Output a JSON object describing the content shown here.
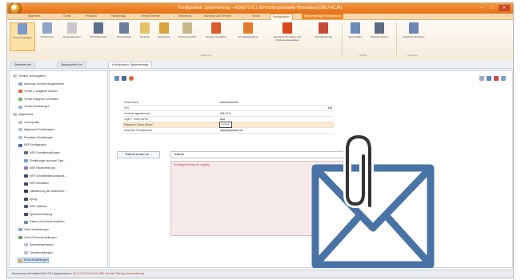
{
  "window": {
    "title": "Konfiguration: Systemeintrag – AQASYS 6.1 (Einrichtungsbeispiel Hörsaalbau) [DEU-ACJA]"
  },
  "menu_tabs": [
    "Allgemein",
    "Grafik",
    "Protokoll",
    "Handelstag",
    "Termin/Termine",
    "Steuerung",
    "Warnung und Termine",
    "Extras",
    "Konfiguration"
  ],
  "special_tab": "Planwerkzeuge Konfigurieren",
  "ribbon": {
    "buttons": [
      {
        "label": "Prozessvariablen",
        "color": "#7a98c9"
      },
      {
        "label": "PV-Bereiche",
        "color": "#8fa7c7"
      },
      {
        "label": "Datenparameter",
        "color": "#c9c9c9"
      },
      {
        "label": "SPS-Parameter",
        "color": "#5c6f8a"
      },
      {
        "label": "Prozessbilder",
        "color": "#6b7f99"
      },
      {
        "label": "Protokoll",
        "color": "#e6c26b"
      },
      {
        "label": "Dokumente",
        "color": "#d9a33e"
      },
      {
        "label": "Rechtevorschrift",
        "color": "#c7b98c"
      },
      {
        "label": "Stundenverwaltung",
        "color": "#d95a2b"
      },
      {
        "label": "Prioritätsausgänge",
        "color": "#e07d2a"
      },
      {
        "label": "Erweiterte Prioritäten und Quittierungsausgänge",
        "color": "#d9481e"
      },
      {
        "label": "Fernalarmierung",
        "color": "#c44b3a"
      },
      {
        "label": "Systemdaten",
        "color": "#6b8cb8"
      },
      {
        "label": "Passwort ändern",
        "color": "#5b6c82"
      },
      {
        "label": "Registrierschlüsseln",
        "color": "#6c86b6"
      }
    ],
    "groups": [
      "Allgemein",
      "System",
      "Sonstiges"
    ]
  },
  "doc_tabs": [
    "Startseite.frm",
    "Datenquellen.frm",
    "Konfiguration: Systemeintrag"
  ],
  "sidebar": {
    "items": [
      {
        "label": "Termine und Aufgaben",
        "indent": 0,
        "color": "#c0c7d1"
      },
      {
        "label": "Wartungs-Termine reorganisieren",
        "indent": 1,
        "color": "#8fa7c7"
      },
      {
        "label": "Termin u. Aufgaben löschen",
        "indent": 1,
        "color": "#d36a4d"
      },
      {
        "label": "Termin-Kategorien verwalten",
        "indent": 1,
        "color": "#7bb26b"
      },
      {
        "label": "Termin-Einstellungen",
        "indent": 1,
        "color": "#9ab0cf"
      },
      {
        "label": "Allgemeines",
        "indent": 0,
        "color": "#c0c7d1"
      },
      {
        "label": "Lizenzprofile",
        "indent": 1,
        "color": "#b6c4d4"
      },
      {
        "label": "Allgemeine Einstellungen",
        "indent": 1,
        "color": "#b6c4d4"
      },
      {
        "label": "Erweiterte Einstellungen",
        "indent": 1,
        "color": "#b6c4d4"
      },
      {
        "label": "NSP Konfiguration",
        "indent": 1,
        "color": "#4d6d99"
      },
      {
        "label": "NSP-Grundeinstellungen",
        "indent": 2,
        "color": "#5c6f8a"
      },
      {
        "label": "Einstellungen automat. Spei...",
        "indent": 2,
        "color": "#6fa0d3"
      },
      {
        "label": "NSP-Parametrierung",
        "indent": 2,
        "color": "#8e7bb8"
      },
      {
        "label": "NSP-Schnittstellenkonfigurat...",
        "indent": 2,
        "color": "#3d4a60"
      },
      {
        "label": "NSP-Simulation",
        "indent": 2,
        "color": "#3d4a60"
      },
      {
        "label": "Initialisierung der Modemsch...",
        "indent": 2,
        "color": "#2f3a4d"
      },
      {
        "label": "Sprog",
        "indent": 2,
        "color": "#3d4a60"
      },
      {
        "label": "NSP-Optionen",
        "indent": 2,
        "color": "#4a5a73"
      },
      {
        "label": "Speicherauflösung",
        "indent": 2,
        "color": "#3d4a60"
      },
      {
        "label": "Datum und Uhrzeit einstellen",
        "indent": 2,
        "color": "#6f8aa8"
      },
      {
        "label": "Client-Verbindungen",
        "indent": 1,
        "color": "#8fa7c7"
      },
      {
        "label": "Client-/Servereinstellungen",
        "indent": 1,
        "color": "#6fa06b"
      },
      {
        "label": "Servereinstellungen",
        "indent": 2,
        "color": "#b6c4d4"
      },
      {
        "label": "Clienteinstellungen",
        "indent": 2,
        "color": "#b6c4d4"
      },
      {
        "label": "Email-Einstellungen",
        "indent": 1,
        "color": "#e1b35a"
      }
    ]
  },
  "form": {
    "fields": [
      {
        "label": "Smtp-Server",
        "value": "www.sofrant.de",
        "num": ""
      },
      {
        "label": "Port",
        "value": "",
        "num": "465"
      },
      {
        "label": "Verbindungssicherheit",
        "value": "SSL/TLS",
        "num": ""
      },
      {
        "label": "Login f. Smtp-Server",
        "value": "kauf",
        "num": ""
      },
      {
        "label": "Passwort f. Smtp-Server",
        "value": "*********",
        "num": ""
      },
      {
        "label": "Absender-Emailadresse",
        "value": "aqasys@sofrant.de",
        "num": ""
      }
    ],
    "test_button": "Testmail senden an ...",
    "subject": "Testmail",
    "body_hint": "Empfängeradresse ist ungültig"
  },
  "status": {
    "text": "Berechnung Jahresbericht für 2014 abgeschlossen.",
    "error": "06.01.2015 18:10:49 | 888: Zentrale Störung Hauswerkzeuge"
  }
}
